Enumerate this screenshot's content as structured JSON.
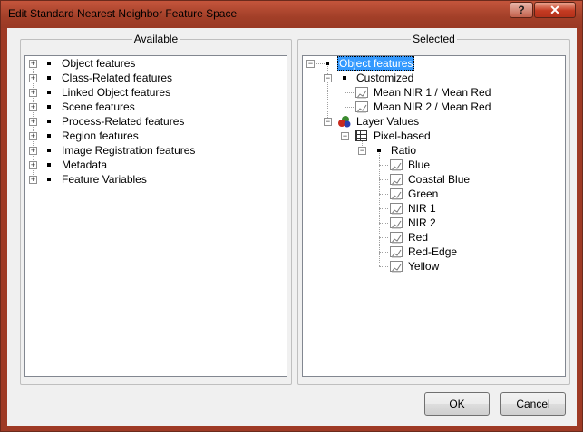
{
  "window": {
    "title": "Edit Standard Nearest Neighbor Feature Space",
    "help_glyph": "?",
    "close_glyph": "✕"
  },
  "available": {
    "label": "Available",
    "items": [
      {
        "label": "Object features",
        "icon": "expand-box-icon"
      },
      {
        "label": "Class-Related features",
        "icon": "expand-box-icon"
      },
      {
        "label": "Linked Object features",
        "icon": "expand-box-icon"
      },
      {
        "label": "Scene features",
        "icon": "expand-box-icon"
      },
      {
        "label": "Process-Related features",
        "icon": "expand-box-icon"
      },
      {
        "label": "Region features",
        "icon": "expand-box-icon"
      },
      {
        "label": "Image Registration features",
        "icon": "expand-box-icon"
      },
      {
        "label": "Metadata",
        "icon": "expand-box-icon"
      },
      {
        "label": "Feature Variables",
        "icon": "expand-box-icon"
      }
    ]
  },
  "selected": {
    "label": "Selected",
    "root": "Object features",
    "customized": {
      "label": "Customized",
      "children": [
        "Mean NIR 1 / Mean Red",
        "Mean NIR 2  / Mean Red"
      ]
    },
    "layer_values": {
      "label": "Layer Values",
      "pixel_based": {
        "label": "Pixel-based",
        "ratio": {
          "label": "Ratio",
          "children": [
            "Blue",
            "Coastal Blue",
            "Green",
            "NIR 1",
            "NIR 2",
            "Red",
            "Red-Edge",
            "Yellow"
          ]
        }
      }
    }
  },
  "buttons": {
    "ok": "OK",
    "cancel": "Cancel"
  },
  "colors": {
    "titlebar": "#a23f28",
    "selection": "#3399ff",
    "dialog_bg": "#f0f0f0"
  },
  "glyphs": {
    "expand": "+",
    "collapse": "−"
  }
}
